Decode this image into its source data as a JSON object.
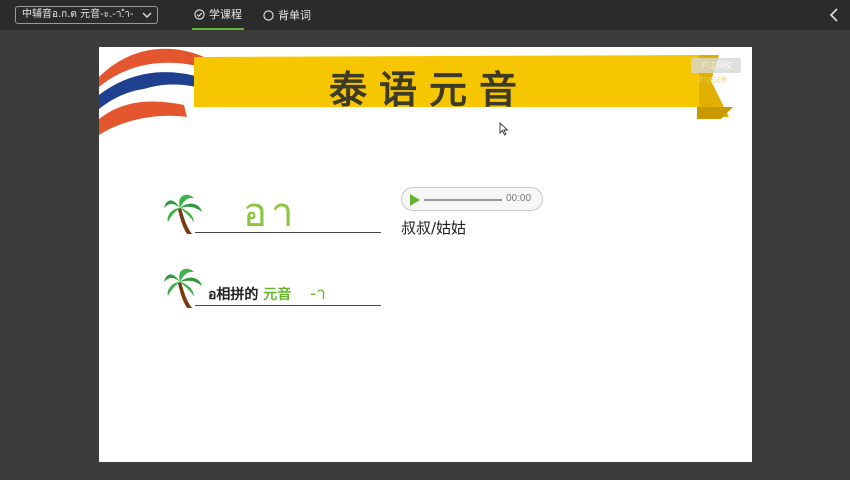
{
  "topbar": {
    "course_select": "中辅音อ.ก.ต 元音-ะ.-า.ำ-",
    "tabs": [
      {
        "label": "学课程",
        "active": true
      },
      {
        "label": "背单词",
        "active": false
      }
    ]
  },
  "slide": {
    "title": "泰语元音",
    "watermark": "沪江网校",
    "watermark_sub": "学习无边界",
    "word": {
      "thai": "อา",
      "audio_time": "00:00",
      "meaning": "叔叔/姑姑"
    },
    "rule": {
      "prefix": "อ相拼的",
      "highlight": "元音",
      "vowel": "-า"
    }
  },
  "colors": {
    "accent_green": "#69b42e",
    "banner_yellow": "#f6c700",
    "flag_red": "#e4572e",
    "flag_blue": "#1f3f8f"
  }
}
